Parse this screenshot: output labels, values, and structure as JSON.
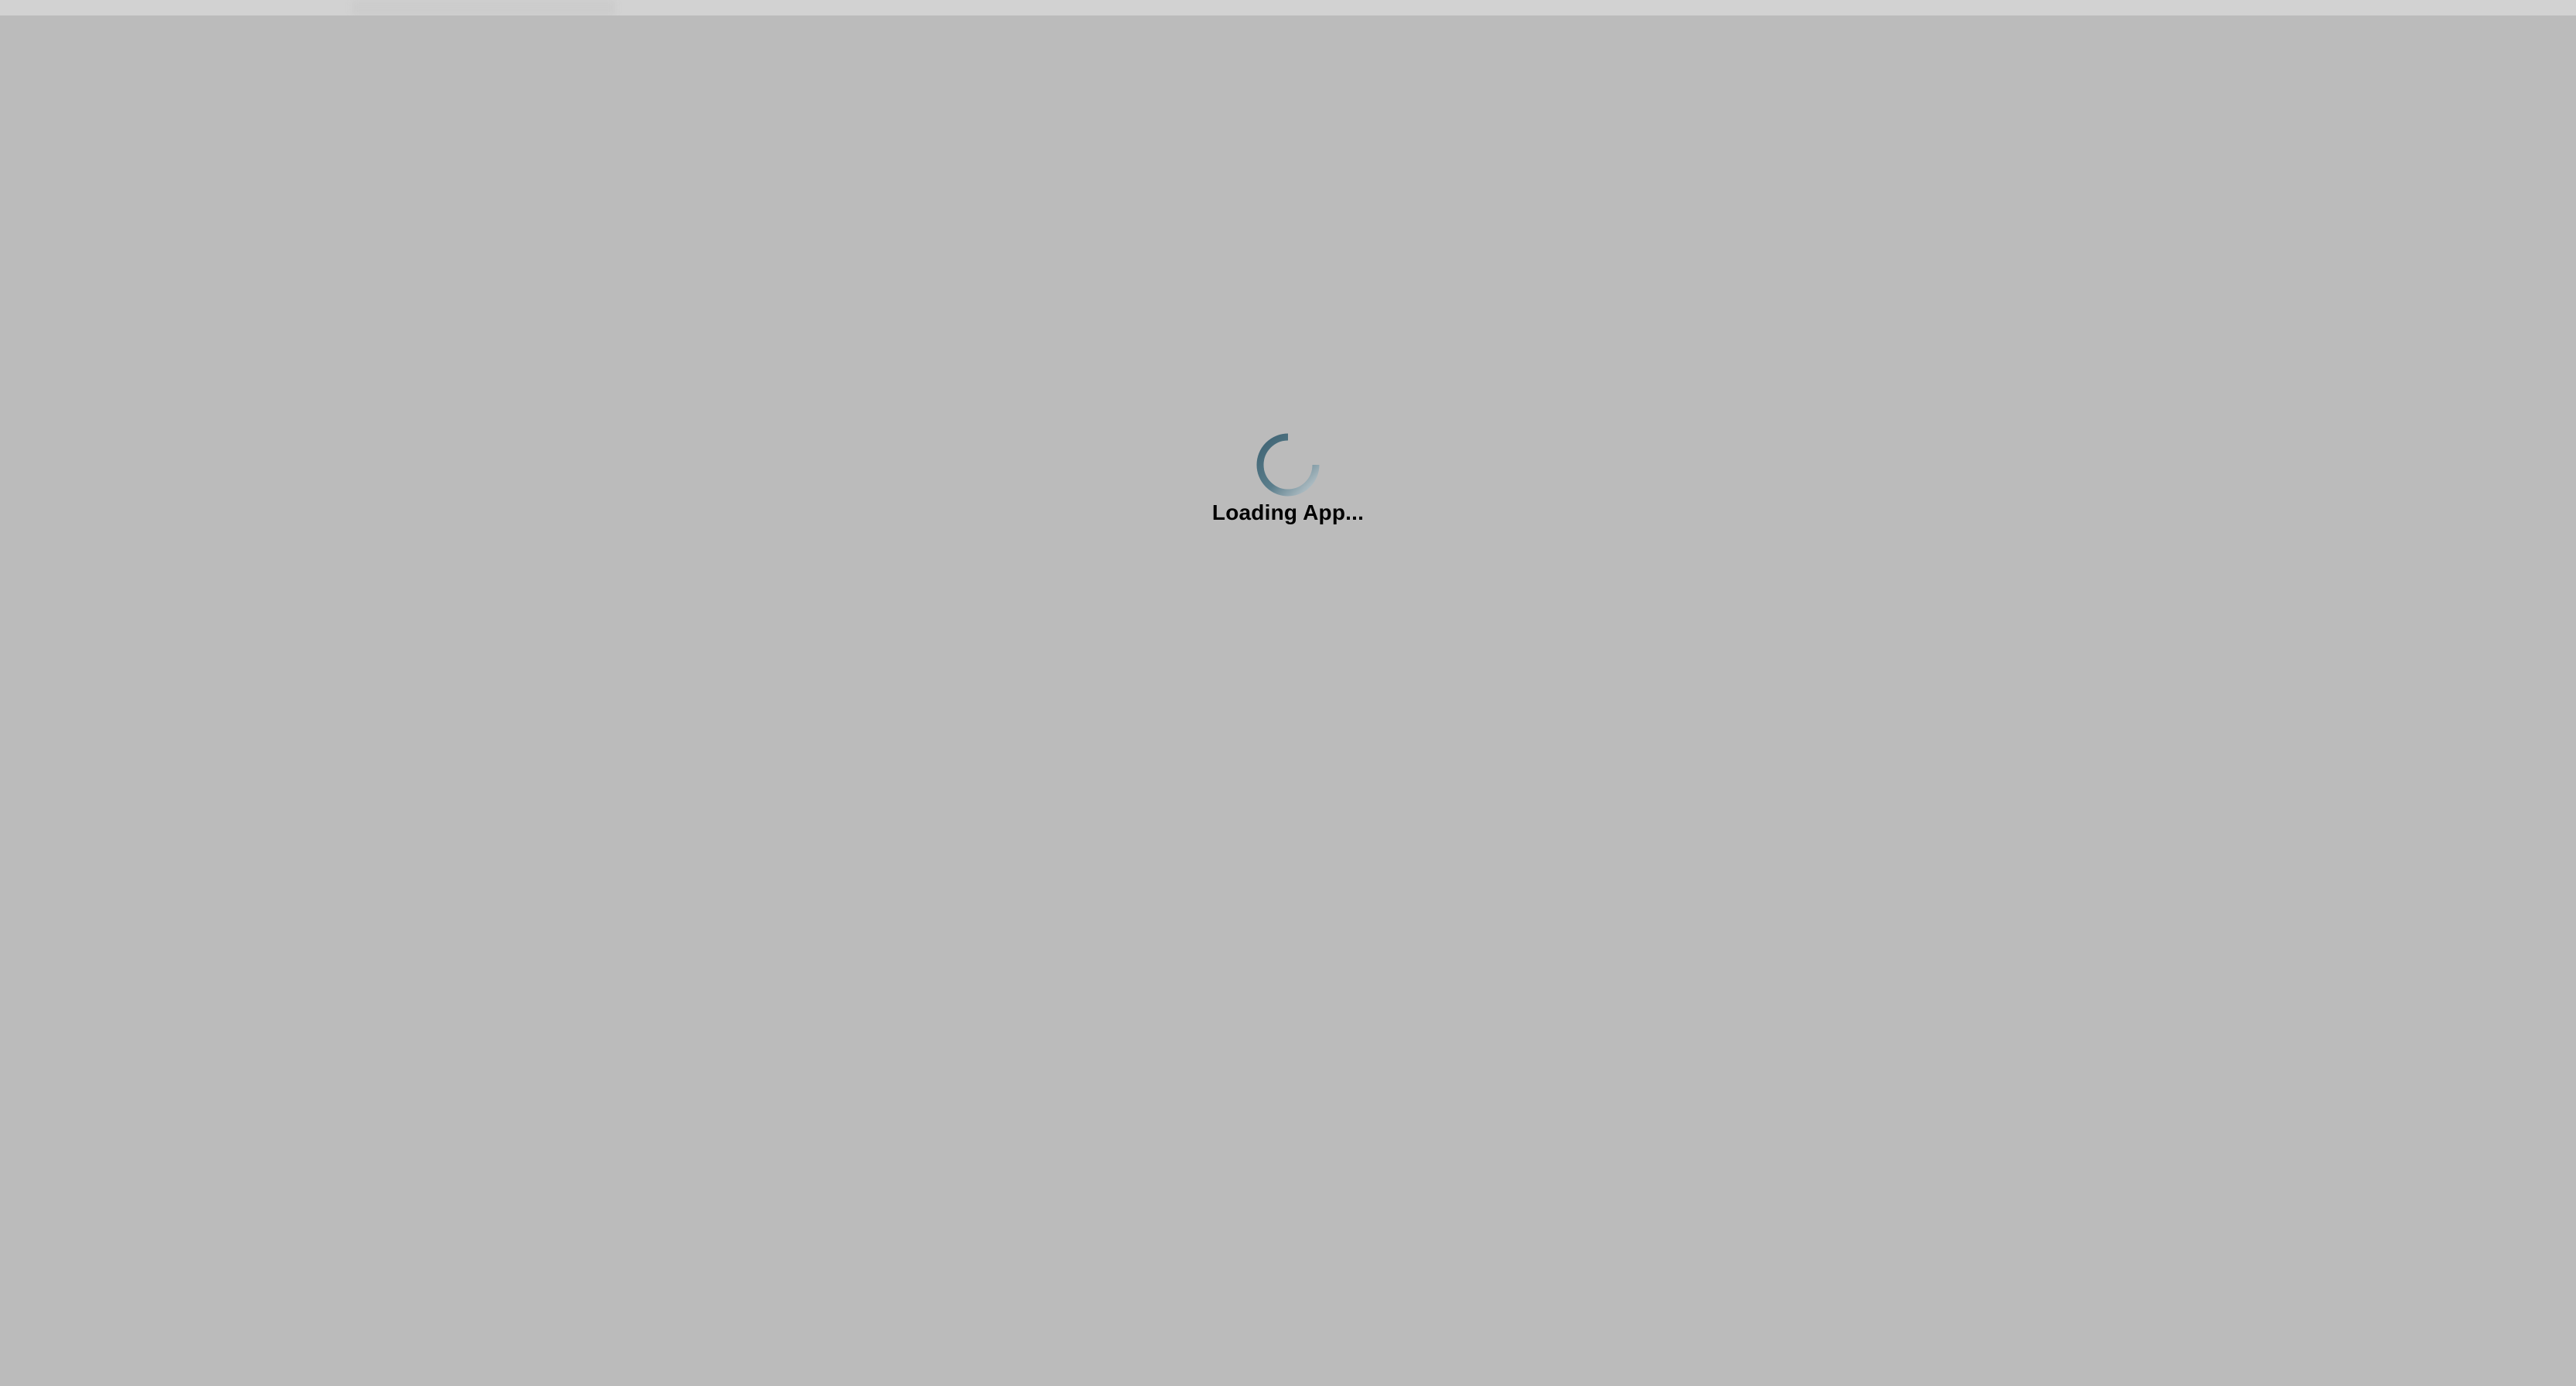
{
  "loader": {
    "text": "Loading App...",
    "spinner_icon": "spinner-icon",
    "spinner_color": "#4f7180"
  },
  "colors": {
    "backdrop": "#bbbbbb",
    "top_strip": "#d2d2d2",
    "text": "#000000"
  }
}
